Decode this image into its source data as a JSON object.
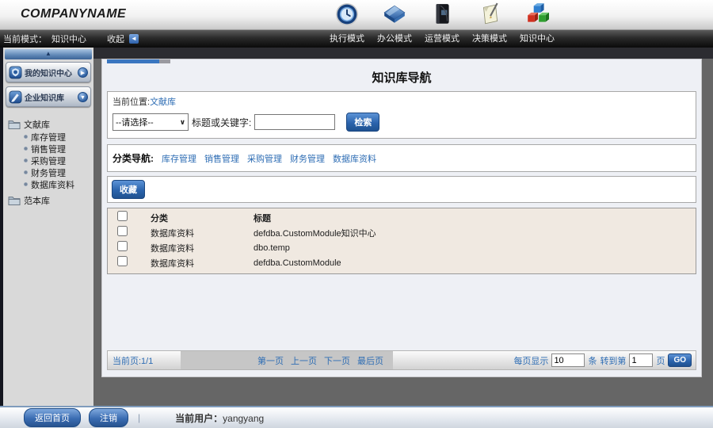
{
  "colors": {
    "accent": "#2e6db4",
    "button_blue": "#2b64ad",
    "table_bg": "#f0e9e1",
    "panel_bg": "#eef0f5"
  },
  "header": {
    "logo": "COMPANYNAME",
    "modules": [
      {
        "label": "执行模式",
        "icon": "clock-icon"
      },
      {
        "label": "办公模式",
        "icon": "diamond-icon"
      },
      {
        "label": "运营模式",
        "icon": "binder-icon"
      },
      {
        "label": "决策模式",
        "icon": "note-pen-icon"
      },
      {
        "label": "知识中心",
        "icon": "cubes-icon"
      }
    ]
  },
  "modebar": {
    "current_label": "当前模式：",
    "current_value": "知识中心",
    "collapse_label": "收起"
  },
  "sidebar": {
    "buttons": [
      {
        "label": "我的知识中心",
        "arrow": "▶"
      },
      {
        "label": "企业知识库",
        "arrow": "▼"
      }
    ],
    "tree": [
      {
        "label": "文献库",
        "children": [
          "库存管理",
          "销售管理",
          "采购管理",
          "财务管理",
          "数据库资料"
        ]
      },
      {
        "label": "范本库",
        "children": []
      }
    ]
  },
  "main": {
    "title": "知识库导航",
    "breadcrumb_label": "当前位置:",
    "breadcrumb_link": "文献库",
    "search": {
      "select_value": "--请选择--",
      "keyword_label": "标题或关键字:",
      "keyword_value": "",
      "search_button": "检索"
    },
    "category_nav": {
      "label": "分类导航:",
      "links": [
        "库存管理",
        "销售管理",
        "采购管理",
        "财务管理",
        "数据库资料"
      ]
    },
    "favorite_button": "收藏",
    "table": {
      "headers": [
        "分类",
        "标题"
      ],
      "rows": [
        {
          "category": "数据库资料",
          "title": "defdba.CustomModule知识中心"
        },
        {
          "category": "数据库资料",
          "title": "dbo.temp"
        },
        {
          "category": "数据库资料",
          "title": "defdba.CustomModule"
        }
      ]
    },
    "pagination": {
      "current": "当前页:1/1",
      "links": [
        "第一页",
        "上一页",
        "下一页",
        "最后页"
      ],
      "per_page_label": "每页显示",
      "per_page_value": "10",
      "unit_label": "条",
      "goto_label": "转到第",
      "goto_value": "1",
      "page_label": "页",
      "go_button": "GO"
    }
  },
  "footer": {
    "home_button": "返回首页",
    "logout_button": "注销",
    "user_label": "当前用户：",
    "user_value": "yangyang"
  }
}
